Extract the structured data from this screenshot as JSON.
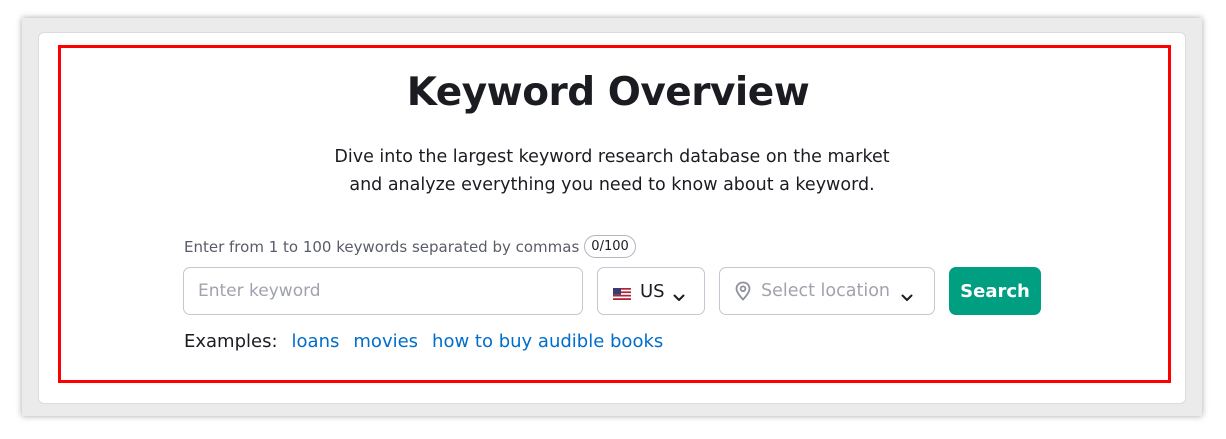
{
  "header": {
    "title": "Keyword Overview",
    "subtitle_line1": "Dive into the largest keyword research database on the market",
    "subtitle_line2": "and analyze everything you need to know about a keyword."
  },
  "form": {
    "hint": "Enter from 1 to 100 keywords separated by commas",
    "counter": "0/100",
    "keyword_input": {
      "value": "",
      "placeholder": "Enter keyword"
    },
    "database": {
      "label": "US",
      "icon": "us-flag-icon"
    },
    "location": {
      "placeholder": "Select location",
      "icon": "location-pin-icon"
    },
    "search_label": "Search"
  },
  "examples": {
    "label": "Examples:",
    "links": [
      "loans",
      "movies",
      "how to buy audible books"
    ]
  },
  "colors": {
    "accent": "#009f81",
    "link": "#006dca",
    "highlight": "#ff0000"
  }
}
